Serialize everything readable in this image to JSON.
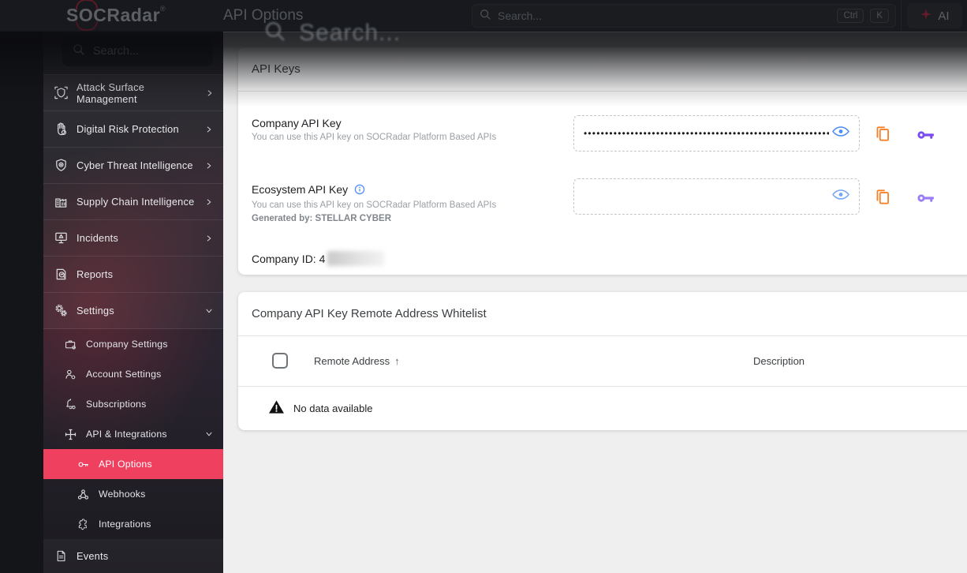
{
  "header": {
    "logo_pre": "S",
    "logo_o": "O",
    "logo_post": "CRadar",
    "logo_reg": "®",
    "page_title": "API Options",
    "search_placeholder": "Search...",
    "shortcut_ctrl": "Ctrl",
    "shortcut_k": "K",
    "ai_label": "AI"
  },
  "overlay": {
    "search_ghost": "Search..."
  },
  "sidebar": {
    "search_placeholder": "Search...",
    "items": [
      {
        "label": "Attack Surface Management",
        "icon": "shield-scan",
        "chevron": "right",
        "level": 0
      },
      {
        "label": "Digital Risk Protection",
        "icon": "hand",
        "chevron": "right",
        "level": 0
      },
      {
        "label": "Cyber Threat Intelligence",
        "icon": "shield-eye",
        "chevron": "right",
        "level": 0
      },
      {
        "label": "Supply Chain Intelligence",
        "icon": "factory",
        "chevron": "right",
        "level": 0
      },
      {
        "label": "Incidents",
        "icon": "monitor-alert",
        "chevron": "right",
        "level": 0
      },
      {
        "label": "Reports",
        "icon": "report",
        "chevron": "none",
        "level": 0
      },
      {
        "label": "Settings",
        "icon": "gears",
        "chevron": "down",
        "level": 0
      },
      {
        "label": "Company Settings",
        "icon": "briefcase",
        "level": 1
      },
      {
        "label": "Account Settings",
        "icon": "user-gear",
        "level": 1
      },
      {
        "label": "Subscriptions",
        "icon": "bell",
        "level": 1
      },
      {
        "label": "API & Integrations",
        "icon": "api-cross",
        "chevron": "down",
        "level": 1
      },
      {
        "label": "API Options",
        "icon": "key",
        "level": 2,
        "active": true
      },
      {
        "label": "Webhooks",
        "icon": "webhook",
        "level": 2
      },
      {
        "label": "Integrations",
        "icon": "puzzle",
        "level": 2
      },
      {
        "label": "Events",
        "icon": "document",
        "level": 0
      }
    ]
  },
  "main": {
    "api_keys_card": {
      "title": "API Keys",
      "company_key": {
        "label": "Company API Key",
        "description": "You can use this API key on SOCRadar Platform Based APIs",
        "masked_value": "••••••••••••••••••••••••••••••••••••••••••••••••••••••••••••"
      },
      "ecosystem_key": {
        "label": "Ecosystem API Key",
        "description": "You can use this API key on SOCRadar Platform Based APIs",
        "generated_by": "Generated by: STELLAR CYBER",
        "value": ""
      },
      "company_id": "Company ID: 4"
    },
    "whitelist_card": {
      "title": "Company API Key Remote Address Whitelist",
      "columns": {
        "remote_address": "Remote Address",
        "sort_arrow": "↑",
        "description": "Description"
      },
      "empty_message": "No data available"
    }
  },
  "colors": {
    "accent_pink": "#ef4060",
    "copy_orange": "#f5812c",
    "key_purple": "#7a4bef",
    "key_purple_light": "#9d7df5",
    "eye_blue": "#4a8cf5",
    "info_blue": "#4a8cf5"
  }
}
